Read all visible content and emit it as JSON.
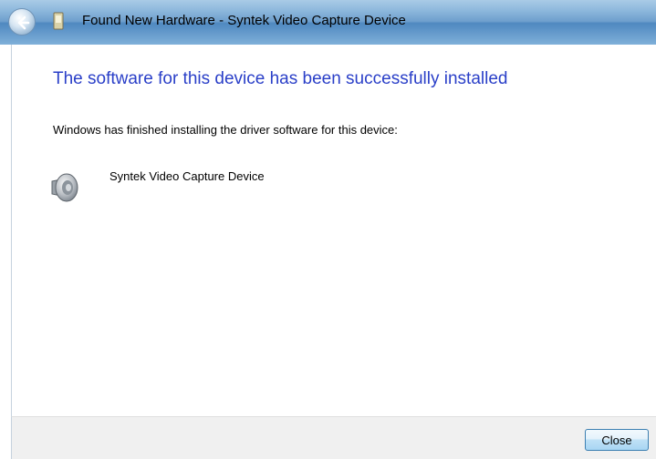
{
  "window": {
    "title": "Found New Hardware - Syntek Video Capture Device"
  },
  "icons": {
    "back": "back-arrow-icon",
    "app": "hardware-icon",
    "device": "speaker-device-icon"
  },
  "main": {
    "heading": "The software for this device has been successfully installed",
    "description": "Windows has finished installing the driver software for this device:",
    "device_name": "Syntek Video Capture Device"
  },
  "footer": {
    "close_label": "Close"
  },
  "colors": {
    "heading": "#2a3fc8",
    "titlebar": "#6e9fcd"
  }
}
